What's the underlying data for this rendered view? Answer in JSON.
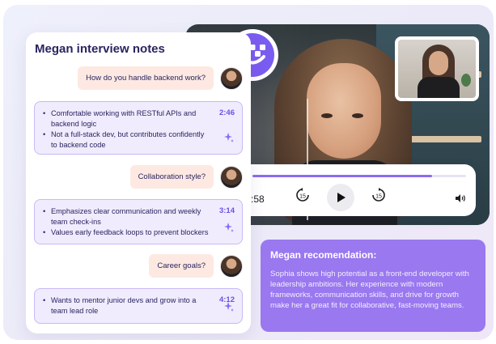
{
  "notes": {
    "title": "Megan interview notes",
    "entries": [
      {
        "question": "How do you handle backend work?",
        "timestamp": "2:46",
        "bullets": [
          "Comfortable working with RESTful APIs and backend logic",
          "Not a full-stack dev, but contributes confidently to backend code"
        ]
      },
      {
        "question": "Collaboration style?",
        "timestamp": "3:14",
        "bullets": [
          "Emphasizes clear communication and weekly team check-ins",
          "Values early feedback loops to prevent blockers"
        ]
      },
      {
        "question": "Career goals?",
        "timestamp": "4:12",
        "bullets": [
          "Wants to mentor junior devs and grow into a team lead role"
        ]
      }
    ]
  },
  "player": {
    "time": ":58",
    "progress": 0.84,
    "rewind_label": "15",
    "forward_label": "15"
  },
  "recommendation": {
    "title": "Megan recomendation:",
    "body": "Sophia shows high potential as a front-end developer with leadership ambitions. Her experience with modern frameworks, communication skills, and drive for growth make her a great fit for collaborative, fast-moving teams."
  },
  "colors": {
    "accent": "#7b5cf0",
    "recommendation_bg": "#9a78ef",
    "question_bubble": "#fde9e2",
    "answer_bg": "#f0ecfd"
  },
  "icons": [
    "megan-logo-icon",
    "rewind-15-icon",
    "play-icon",
    "forward-15-icon",
    "volume-icon",
    "sparkle-icon"
  ]
}
